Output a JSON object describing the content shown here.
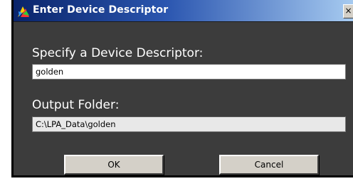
{
  "window": {
    "title": "Enter Device Descriptor",
    "close_glyph": "×",
    "icon": "app-icon"
  },
  "form": {
    "descriptor_label": "Specify a Device Descriptor:",
    "descriptor_value": "golden",
    "output_label": "Output Folder:",
    "output_value": "C:\\LPA_Data\\golden"
  },
  "buttons": {
    "ok_label": "OK",
    "cancel_label": "Cancel"
  },
  "colors": {
    "dialog_background": "#3c3c3c",
    "titlebar_start": "#0a246a",
    "titlebar_end": "#a6caf0",
    "button_face": "#d4d0c8"
  }
}
